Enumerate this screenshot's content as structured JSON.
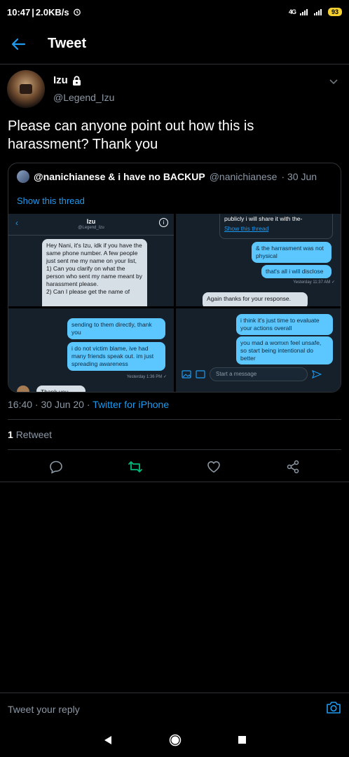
{
  "status_bar": {
    "time": "10:47",
    "speed": "2.0KB/s",
    "network": "4G",
    "battery": "93"
  },
  "header": {
    "title": "Tweet"
  },
  "tweet": {
    "author_name": "Izu",
    "author_handle": "@Legend_Izu",
    "text": "Please can anyone point out how this is harassment? Thank you",
    "timestamp": "16:40 · 30 Jun 20 · ",
    "source": "Twitter for iPhone",
    "retweet_count": "1",
    "retweet_label": "Retweet"
  },
  "quote": {
    "name": "@nanichianese & i have no BACKUP",
    "handle": "@nanichianese",
    "date": "· 30 Jun",
    "show_thread": "Show this thread",
    "images": {
      "p1": {
        "title": "Izu",
        "subtitle": "@Legend_Izu",
        "message": "Hey Nani, it's Izu, idk if you have the same phone number. A few people just sent me my name on your list,\n1) Can you clarify on what the person who sent my name meant by harassment please.\n2) Can I please get the name of"
      },
      "p2": {
        "top_text": "publicly i will share it with the-",
        "show_thread": "Show this thread",
        "msg1": "& the harrasment was not physical",
        "msg2": "that's all i will disclose",
        "meta": "Yesterday 11:37 AM ✓",
        "msg3": "Again thanks for your response."
      },
      "p3": {
        "msg1": "sending to them directly, thank you",
        "msg2": "i do not victim blame, ive had many friends speak out. im just spreading awareness",
        "meta": "Yesterday 1:36 PM ✓",
        "msg3": "Thank you"
      },
      "p4": {
        "msg1": "i think it's just time to evaluate your actions overall",
        "msg2": "you mad a womxn feel unsafe, so start being intentional do better",
        "input_placeholder": "Start a message"
      }
    }
  },
  "reply": {
    "placeholder": "Tweet your reply"
  },
  "colors": {
    "accent": "#1d9bf0",
    "retweet_green": "#00ba7c",
    "background": "#000000"
  },
  "icons": [
    "back-arrow-icon",
    "lock-icon",
    "chevron-down-icon",
    "reply-icon",
    "retweet-icon",
    "like-icon",
    "share-icon",
    "camera-icon",
    "nav-back-icon",
    "nav-home-icon",
    "nav-recents-icon"
  ]
}
